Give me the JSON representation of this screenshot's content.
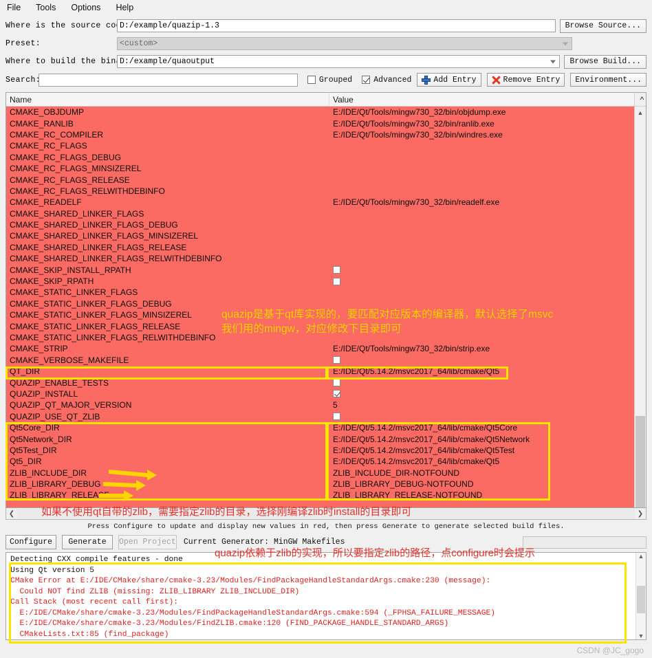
{
  "menu": {
    "items": [
      {
        "label": "File"
      },
      {
        "label": "Tools"
      },
      {
        "label": "Options"
      },
      {
        "label": "Help"
      }
    ]
  },
  "form": {
    "source_label": "Where is the source code:",
    "source_value": "D:/example/quazip-1.3",
    "browse_source_label": "Browse Source...",
    "preset_label": "Preset:",
    "preset_value": "<custom>",
    "build_label": "Where to build the binaries:",
    "build_value": "D:/example/quaoutput",
    "browse_build_label": "Browse Build...",
    "search_label": "Search:",
    "search_value": "",
    "grouped_label": "Grouped",
    "grouped_checked": false,
    "advanced_label": "Advanced",
    "advanced_checked": true,
    "add_entry_label": "Add Entry",
    "remove_entry_label": "Remove Entry",
    "environment_label": "Environment..."
  },
  "table": {
    "header_name": "Name",
    "header_value": "Value",
    "rows": [
      {
        "name": "CMAKE_OBJDUMP",
        "value": "E:/IDE/Qt/Tools/mingw730_32/bin/objdump.exe",
        "type": "text"
      },
      {
        "name": "CMAKE_RANLIB",
        "value": "E:/IDE/Qt/Tools/mingw730_32/bin/ranlib.exe",
        "type": "text"
      },
      {
        "name": "CMAKE_RC_COMPILER",
        "value": "E:/IDE/Qt/Tools/mingw730_32/bin/windres.exe",
        "type": "text"
      },
      {
        "name": "CMAKE_RC_FLAGS",
        "value": "",
        "type": "text"
      },
      {
        "name": "CMAKE_RC_FLAGS_DEBUG",
        "value": "",
        "type": "text"
      },
      {
        "name": "CMAKE_RC_FLAGS_MINSIZEREL",
        "value": "",
        "type": "text"
      },
      {
        "name": "CMAKE_RC_FLAGS_RELEASE",
        "value": "",
        "type": "text"
      },
      {
        "name": "CMAKE_RC_FLAGS_RELWITHDEBINFO",
        "value": "",
        "type": "text"
      },
      {
        "name": "CMAKE_READELF",
        "value": "E:/IDE/Qt/Tools/mingw730_32/bin/readelf.exe",
        "type": "text"
      },
      {
        "name": "CMAKE_SHARED_LINKER_FLAGS",
        "value": "",
        "type": "text"
      },
      {
        "name": "CMAKE_SHARED_LINKER_FLAGS_DEBUG",
        "value": "",
        "type": "text"
      },
      {
        "name": "CMAKE_SHARED_LINKER_FLAGS_MINSIZEREL",
        "value": "",
        "type": "text"
      },
      {
        "name": "CMAKE_SHARED_LINKER_FLAGS_RELEASE",
        "value": "",
        "type": "text"
      },
      {
        "name": "CMAKE_SHARED_LINKER_FLAGS_RELWITHDEBINFO",
        "value": "",
        "type": "text"
      },
      {
        "name": "CMAKE_SKIP_INSTALL_RPATH",
        "value": "",
        "type": "checkbox",
        "checked": false
      },
      {
        "name": "CMAKE_SKIP_RPATH",
        "value": "",
        "type": "checkbox",
        "checked": false
      },
      {
        "name": "CMAKE_STATIC_LINKER_FLAGS",
        "value": "",
        "type": "text"
      },
      {
        "name": "CMAKE_STATIC_LINKER_FLAGS_DEBUG",
        "value": "",
        "type": "text"
      },
      {
        "name": "CMAKE_STATIC_LINKER_FLAGS_MINSIZEREL",
        "value": "",
        "type": "text"
      },
      {
        "name": "CMAKE_STATIC_LINKER_FLAGS_RELEASE",
        "value": "",
        "type": "text"
      },
      {
        "name": "CMAKE_STATIC_LINKER_FLAGS_RELWITHDEBINFO",
        "value": "",
        "type": "text"
      },
      {
        "name": "CMAKE_STRIP",
        "value": "E:/IDE/Qt/Tools/mingw730_32/bin/strip.exe",
        "type": "text"
      },
      {
        "name": "CMAKE_VERBOSE_MAKEFILE",
        "value": "",
        "type": "checkbox",
        "checked": false
      },
      {
        "name": "QT_DIR",
        "value": "E:/IDE/Qt/5.14.2/msvc2017_64/lib/cmake/Qt5",
        "type": "text"
      },
      {
        "name": "QUAZIP_ENABLE_TESTS",
        "value": "",
        "type": "checkbox",
        "checked": false
      },
      {
        "name": "QUAZIP_INSTALL",
        "value": "",
        "type": "checkbox",
        "checked": true
      },
      {
        "name": "QUAZIP_QT_MAJOR_VERSION",
        "value": "5",
        "type": "text"
      },
      {
        "name": "QUAZIP_USE_QT_ZLIB",
        "value": "",
        "type": "checkbox",
        "checked": false
      },
      {
        "name": "Qt5Core_DIR",
        "value": "E:/IDE/Qt/5.14.2/msvc2017_64/lib/cmake/Qt5Core",
        "type": "text"
      },
      {
        "name": "Qt5Network_DIR",
        "value": "E:/IDE/Qt/5.14.2/msvc2017_64/lib/cmake/Qt5Network",
        "type": "text"
      },
      {
        "name": "Qt5Test_DIR",
        "value": "E:/IDE/Qt/5.14.2/msvc2017_64/lib/cmake/Qt5Test",
        "type": "text"
      },
      {
        "name": "Qt5_DIR",
        "value": "E:/IDE/Qt/5.14.2/msvc2017_64/lib/cmake/Qt5",
        "type": "text"
      },
      {
        "name": "ZLIB_INCLUDE_DIR",
        "value": "ZLIB_INCLUDE_DIR-NOTFOUND",
        "type": "text"
      },
      {
        "name": "ZLIB_LIBRARY_DEBUG",
        "value": "ZLIB_LIBRARY_DEBUG-NOTFOUND",
        "type": "text"
      },
      {
        "name": "ZLIB_LIBRARY_RELEASE",
        "value": "ZLIB_LIBRARY_RELEASE-NOTFOUND",
        "type": "text"
      }
    ]
  },
  "hint": "Press Configure to update and display new values in red, then press Generate to generate selected build files.",
  "actions": {
    "configure_label": "Configure",
    "generate_label": "Generate",
    "open_project_label": "Open Project",
    "generator_label": "Current Generator: MinGW Makefiles"
  },
  "log": {
    "lines": [
      {
        "text": "Detecting CXX compile features - done",
        "kind": "normal"
      },
      {
        "text": "Using Qt version 5",
        "kind": "normal"
      },
      {
        "text": "CMake Error at E:/IDE/CMake/share/cmake-3.23/Modules/FindPackageHandleStandardArgs.cmake:230 (message):",
        "kind": "err"
      },
      {
        "text": "  Could NOT find ZLIB (missing: ZLIB_LIBRARY ZLIB_INCLUDE_DIR)",
        "kind": "err"
      },
      {
        "text": "Call Stack (most recent call first):",
        "kind": "err"
      },
      {
        "text": "  E:/IDE/CMake/share/cmake-3.23/Modules/FindPackageHandleStandardArgs.cmake:594 (_FPHSA_FAILURE_MESSAGE)",
        "kind": "err"
      },
      {
        "text": "  E:/IDE/CMake/share/cmake-3.23/Modules/FindZLIB.cmake:120 (FIND_PACKAGE_HANDLE_STANDARD_ARGS)",
        "kind": "err"
      },
      {
        "text": "  CMakeLists.txt:85 (find_package)",
        "kind": "err"
      }
    ]
  },
  "annotations": {
    "note_compiler": "quazip是基于qt库实现的，要匹配对应版本的编译器，默认选择了msvc\n我们用的mingw，对应修改下目录即可",
    "note_zlib_dir": "如果不使用qt自带的zlib，需要指定zlib的目录，选择刚编译zlib时install的目录即可",
    "note_configure": "quazip依赖于zlib的实现，所以要指定zlib的路径，点configure时会提示",
    "highlight_color": "#ffe400",
    "yellow_text_color": "#ffd400",
    "red_text_color": "#e8302a"
  },
  "watermark": "CSDN @JC_gogo"
}
